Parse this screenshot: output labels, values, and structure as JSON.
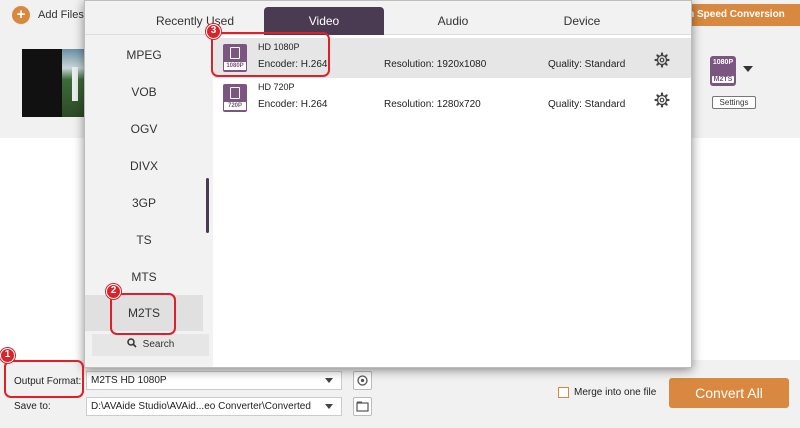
{
  "app": {
    "add_files": "Add Files",
    "high_speed": "gh Speed Conversion",
    "right_format_icon": {
      "top": "1080P",
      "bottom": "M2TS"
    },
    "settings": "Settings"
  },
  "dialog": {
    "tabs": [
      {
        "label": "Recently Used",
        "active": false
      },
      {
        "label": "Video",
        "active": true
      },
      {
        "label": "Audio",
        "active": false
      },
      {
        "label": "Device",
        "active": false
      }
    ],
    "formats": [
      {
        "label": "MPEG"
      },
      {
        "label": "VOB"
      },
      {
        "label": "OGV"
      },
      {
        "label": "DIVX"
      },
      {
        "label": "3GP"
      },
      {
        "label": "TS"
      },
      {
        "label": "MTS"
      },
      {
        "label": "M2TS",
        "selected": true
      }
    ],
    "search": "Search",
    "presets": [
      {
        "name": "HD 1080P",
        "icon_tag": "1080P",
        "encoder": "Encoder: H.264",
        "resolution": "Resolution: 1920x1080",
        "quality": "Quality: Standard",
        "selected": true
      },
      {
        "name": "HD 720P",
        "icon_tag": "720P",
        "encoder": "Encoder: H.264",
        "resolution": "Resolution: 1280x720",
        "quality": "Quality: Standard",
        "selected": false
      }
    ]
  },
  "bottom": {
    "output_format_label": "Output Format:",
    "output_format_value": "M2TS HD 1080P",
    "save_to_label": "Save to:",
    "save_to_value": "D:\\AVAide Studio\\AVAid...eo Converter\\Converted",
    "merge_label": "Merge into one file",
    "convert_all": "Convert All"
  },
  "annotations": {
    "step1": "1",
    "step2": "2",
    "step3": "3",
    "color": "#e02028"
  },
  "colors": {
    "accent": "#d8893f",
    "tab_active": "#4a3a52",
    "format_icon": "#7a5680"
  }
}
